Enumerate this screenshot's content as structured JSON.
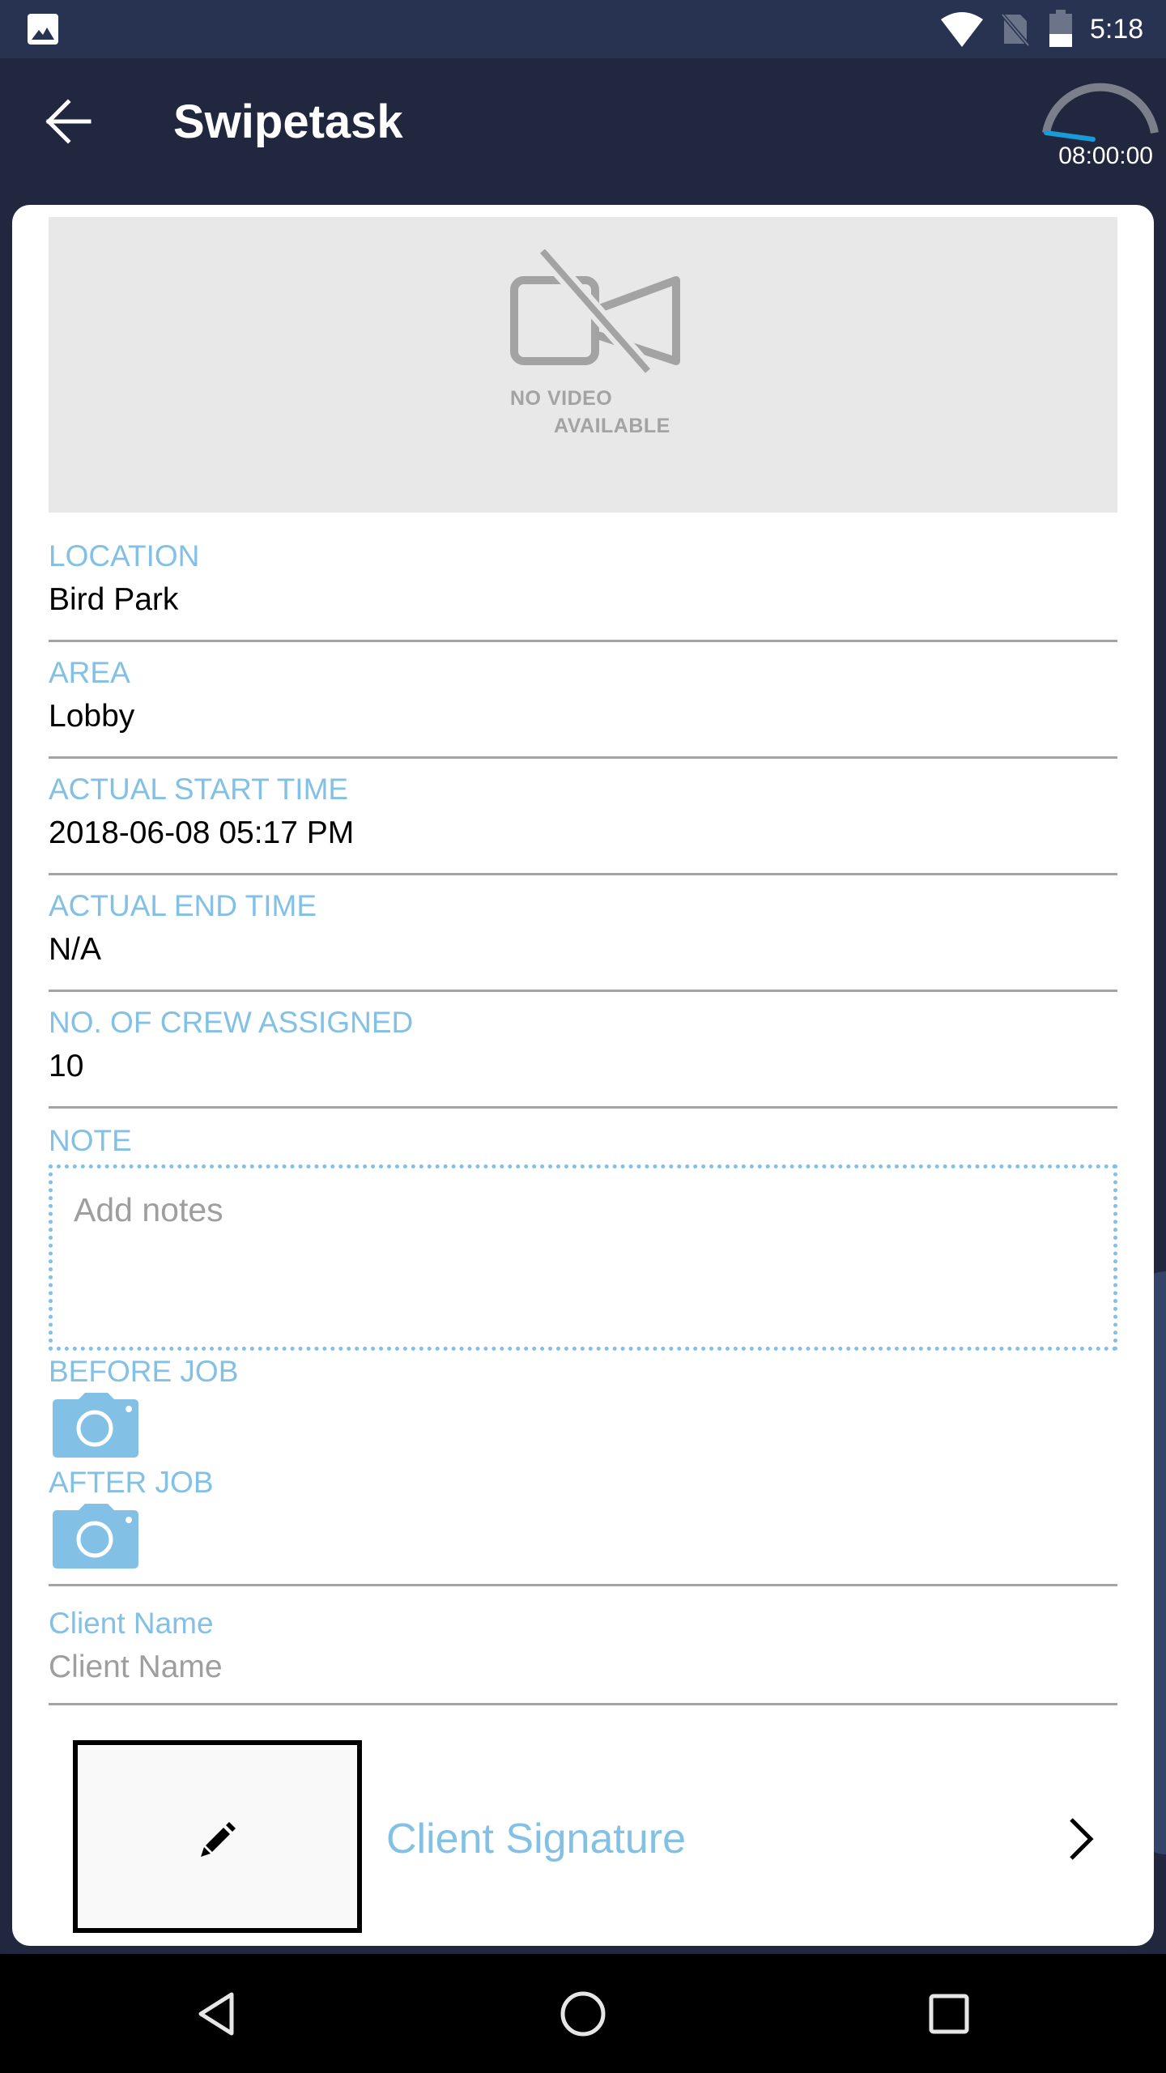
{
  "status_bar": {
    "time": "5:18",
    "icons": [
      "gallery-icon",
      "wifi-icon",
      "no-sim-icon",
      "battery-icon"
    ]
  },
  "app_bar": {
    "back_icon": "arrow-left-icon",
    "title": "Swipetask",
    "timer": "08:00:00",
    "timer_gauge_icon": "gauge-icon"
  },
  "video": {
    "icon": "video-off-icon",
    "text_line1": "NO VIDEO",
    "text_line2": "AVAILABLE"
  },
  "fields": [
    {
      "label": "LOCATION",
      "value": "Bird Park"
    },
    {
      "label": "AREA",
      "value": "Lobby"
    },
    {
      "label": "ACTUAL START TIME",
      "value": "2018-06-08 05:17 PM"
    },
    {
      "label": "ACTUAL END TIME",
      "value": "N/A"
    },
    {
      "label": "NO. OF CREW ASSIGNED",
      "value": "10"
    }
  ],
  "note": {
    "label": "NOTE",
    "placeholder": "Add notes",
    "value": ""
  },
  "photos": {
    "before_label": "BEFORE JOB",
    "after_label": "AFTER JOB",
    "icon": "camera-icon"
  },
  "client_name": {
    "label": "Client Name",
    "placeholder": "Client Name",
    "value": ""
  },
  "signature": {
    "label": "Client Signature",
    "icon": "pencil-icon",
    "chevron": "chevron-right-icon"
  },
  "nav_bar": {
    "buttons": [
      "back",
      "home",
      "recents"
    ]
  },
  "colors": {
    "accent": "#83c0e6",
    "app_bar": "#21273f",
    "status_bar": "#273350",
    "gauge_progress": "#1a9bd7",
    "gauge_track": "#7b7f8c"
  }
}
